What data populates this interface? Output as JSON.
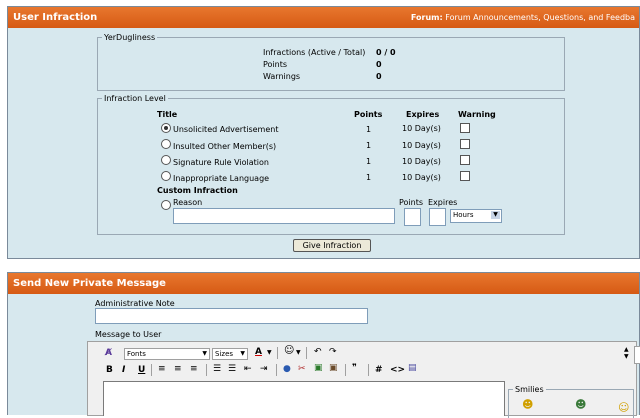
{
  "infraction_panel": {
    "title": "User Infraction",
    "forum_label": "Forum:",
    "forum_name": "Forum Announcements, Questions, and Feedba",
    "user_fieldset": {
      "legend": "YerDugliness",
      "rows": [
        {
          "label": "Infractions (Active / Total)",
          "value": "0 / 0"
        },
        {
          "label": "Points",
          "value": "0"
        },
        {
          "label": "Warnings",
          "value": "0"
        }
      ]
    },
    "level_fieldset": {
      "legend": "Infraction Level",
      "headers": {
        "title": "Title",
        "points": "Points",
        "expires": "Expires",
        "warning": "Warning"
      },
      "rows": [
        {
          "title": "Unsolicited Advertisement",
          "points": "1",
          "expires": "10 Day(s)",
          "selected": true
        },
        {
          "title": "Insulted Other Member(s)",
          "points": "1",
          "expires": "10 Day(s)",
          "selected": false
        },
        {
          "title": "Signature Rule Violation",
          "points": "1",
          "expires": "10 Day(s)",
          "selected": false
        },
        {
          "title": "Inappropriate Language",
          "points": "1",
          "expires": "10 Day(s)",
          "selected": false
        }
      ],
      "custom": {
        "heading": "Custom Infraction",
        "reason_label": "Reason",
        "points_label": "Points",
        "expires_label": "Expires",
        "period_value": "Hours"
      }
    },
    "submit_label": "Give Infraction"
  },
  "pm_panel": {
    "title": "Send New Private Message",
    "admin_note_label": "Administrative Note",
    "message_label": "Message to User",
    "toolbar": {
      "font_value": "Fonts",
      "size_value": "Sizes",
      "font_color_glyph": "A",
      "bold": "B",
      "italic": "I",
      "underline": "U",
      "hash": "#",
      "code": "<>"
    },
    "smilies_legend": "Smilies"
  },
  "colors": {
    "header_orange": "#d65a14",
    "panel_bg": "#d7e8ee"
  }
}
